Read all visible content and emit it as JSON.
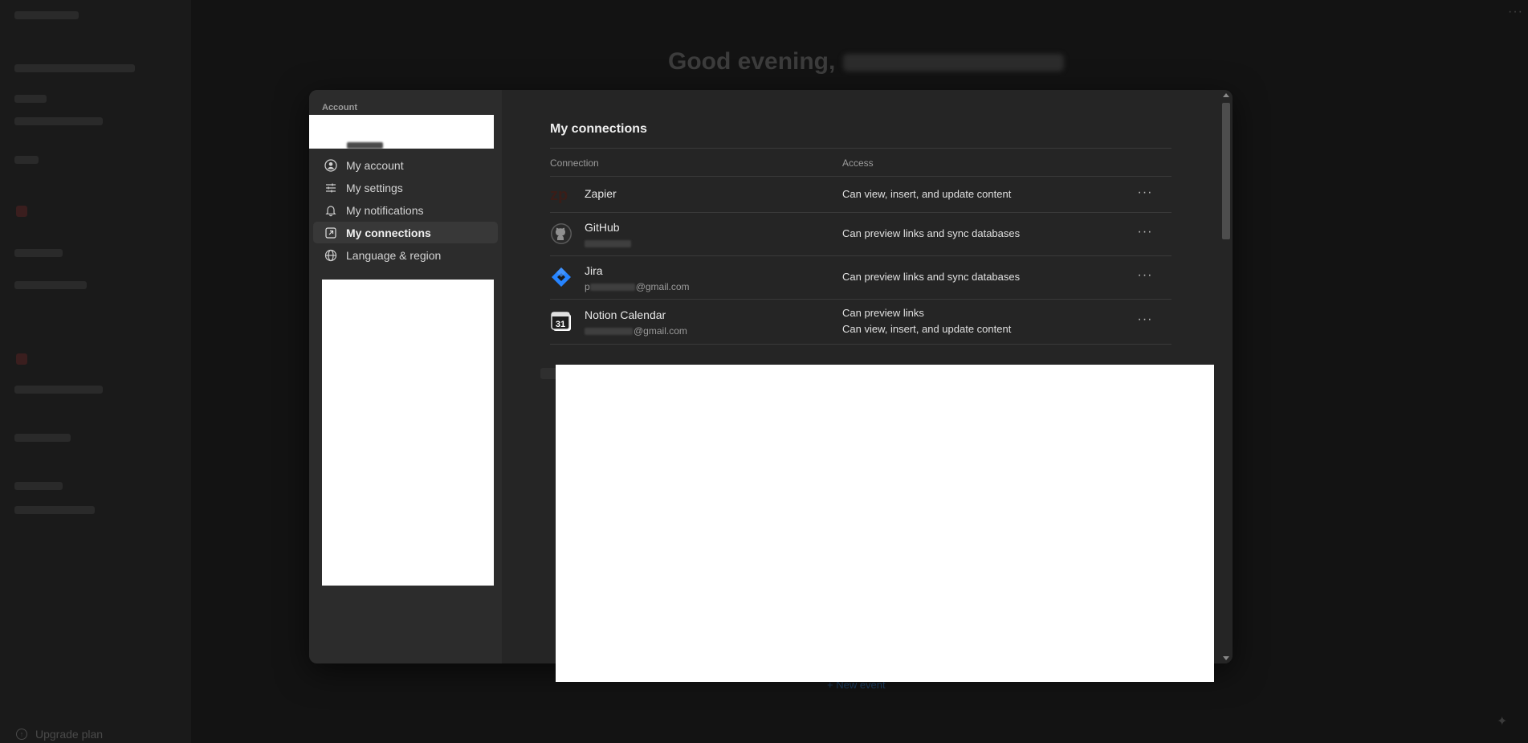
{
  "background": {
    "greeting": "Good evening,",
    "upgrade_label": "Upgrade plan",
    "new_event_label": "+ New event",
    "more_dots": "···",
    "sparkle_icon": "sparkle-icon"
  },
  "settings": {
    "section_label": "Account",
    "nav": [
      {
        "label": "My account",
        "icon": "user-circle-icon",
        "active": false
      },
      {
        "label": "My settings",
        "icon": "sliders-icon",
        "active": false
      },
      {
        "label": "My notifications",
        "icon": "bell-icon",
        "active": false
      },
      {
        "label": "My connections",
        "icon": "external-link-icon",
        "active": true
      },
      {
        "label": "Language & region",
        "icon": "globe-icon",
        "active": false
      }
    ],
    "content": {
      "title": "My connections",
      "col_connection": "Connection",
      "col_access": "Access",
      "rows": [
        {
          "name": "Zapier",
          "account": "",
          "access": [
            "Can view, insert, and update content"
          ],
          "icon": "zapier-logo-icon"
        },
        {
          "name": "GitHub",
          "account": "",
          "access": [
            "Can preview links and sync databases"
          ],
          "icon": "github-logo-icon"
        },
        {
          "name": "Jira",
          "account_prefix": "p",
          "account_suffix": "@gmail.com",
          "access": [
            "Can preview links and sync databases"
          ],
          "icon": "jira-logo-icon"
        },
        {
          "name": "Notion Calendar",
          "account_prefix": "",
          "account_suffix": "@gmail.com",
          "access": [
            "Can preview links",
            "Can view, insert, and update content"
          ],
          "icon": "calendar-31-icon"
        }
      ],
      "more_label": "···"
    }
  },
  "colors": {
    "page_bg": "#131313",
    "modal_bg": "#252525",
    "nav_bg": "#2c2c2c",
    "active_bg": "#383838",
    "jira_blue": "#2684ff"
  }
}
